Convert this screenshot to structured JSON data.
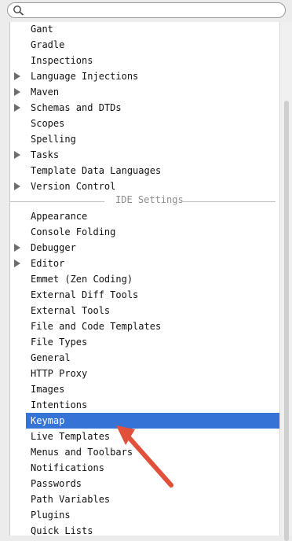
{
  "search": {
    "value": "",
    "placeholder": ""
  },
  "project_items": [
    {
      "label": "Gant",
      "expandable": false
    },
    {
      "label": "Gradle",
      "expandable": false
    },
    {
      "label": "Inspections",
      "expandable": false
    },
    {
      "label": "Language Injections",
      "expandable": true
    },
    {
      "label": "Maven",
      "expandable": true
    },
    {
      "label": "Schemas and DTDs",
      "expandable": true
    },
    {
      "label": "Scopes",
      "expandable": false
    },
    {
      "label": "Spelling",
      "expandable": false
    },
    {
      "label": "Tasks",
      "expandable": true
    },
    {
      "label": "Template Data Languages",
      "expandable": false
    },
    {
      "label": "Version Control",
      "expandable": true
    }
  ],
  "separator_label": "IDE Settings",
  "ide_items": [
    {
      "label": "Appearance",
      "expandable": false
    },
    {
      "label": "Console Folding",
      "expandable": false
    },
    {
      "label": "Debugger",
      "expandable": true
    },
    {
      "label": "Editor",
      "expandable": true
    },
    {
      "label": "Emmet (Zen Coding)",
      "expandable": false
    },
    {
      "label": "External Diff Tools",
      "expandable": false
    },
    {
      "label": "External Tools",
      "expandable": false
    },
    {
      "label": "File and Code Templates",
      "expandable": false
    },
    {
      "label": "File Types",
      "expandable": false
    },
    {
      "label": "General",
      "expandable": false
    },
    {
      "label": "HTTP Proxy",
      "expandable": false
    },
    {
      "label": "Images",
      "expandable": false
    },
    {
      "label": "Intentions",
      "expandable": false
    },
    {
      "label": "Keymap",
      "expandable": false,
      "selected": true
    },
    {
      "label": "Live Templates",
      "expandable": false
    },
    {
      "label": "Menus and Toolbars",
      "expandable": false
    },
    {
      "label": "Notifications",
      "expandable": false
    },
    {
      "label": "Passwords",
      "expandable": false
    },
    {
      "label": "Path Variables",
      "expandable": false
    },
    {
      "label": "Plugins",
      "expandable": false
    },
    {
      "label": "Quick Lists",
      "expandable": false
    }
  ],
  "colors": {
    "selection": "#3574d6",
    "annotation_arrow": "#e0503a"
  }
}
